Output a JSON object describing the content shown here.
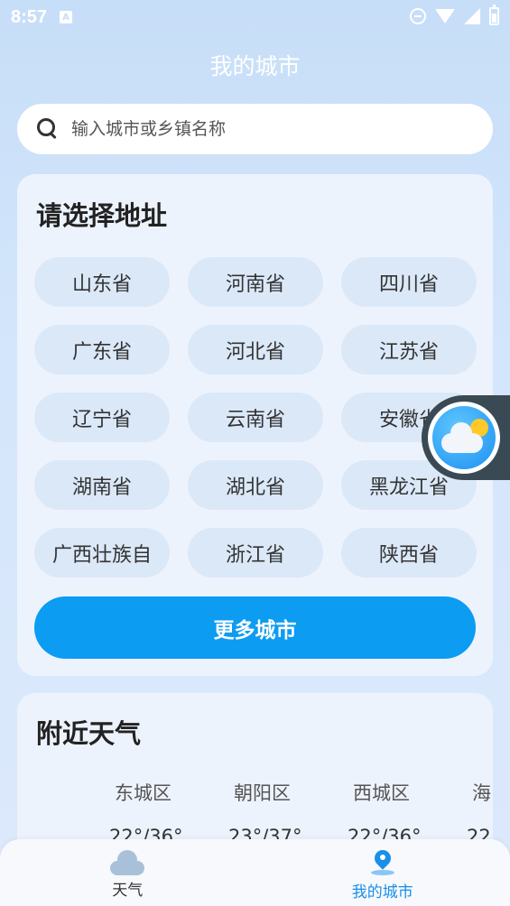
{
  "status_bar": {
    "time": "8:57",
    "notification_badge": "A"
  },
  "header": {
    "title": "我的城市"
  },
  "search": {
    "placeholder": "输入城市或乡镇名称"
  },
  "address_section": {
    "title": "请选择地址",
    "provinces": [
      "山东省",
      "河南省",
      "四川省",
      "广东省",
      "河北省",
      "江苏省",
      "辽宁省",
      "云南省",
      "安徽省",
      "湖南省",
      "湖北省",
      "黑龙江省",
      "广西壮族自",
      "浙江省",
      "陕西省"
    ],
    "more_button": "更多城市"
  },
  "nearby_section": {
    "title": "附近天气",
    "cities": [
      {
        "name": "东城区",
        "temp": "22°/36°"
      },
      {
        "name": "朝阳区",
        "temp": "23°/37°"
      },
      {
        "name": "西城区",
        "temp": "22°/36°"
      },
      {
        "name": "海",
        "temp": "22"
      }
    ]
  },
  "bottom_nav": {
    "weather_label": "天气",
    "city_label": "我的城市"
  },
  "colors": {
    "accent": "#0c9cf2",
    "nav_active": "#1a8fe8"
  }
}
